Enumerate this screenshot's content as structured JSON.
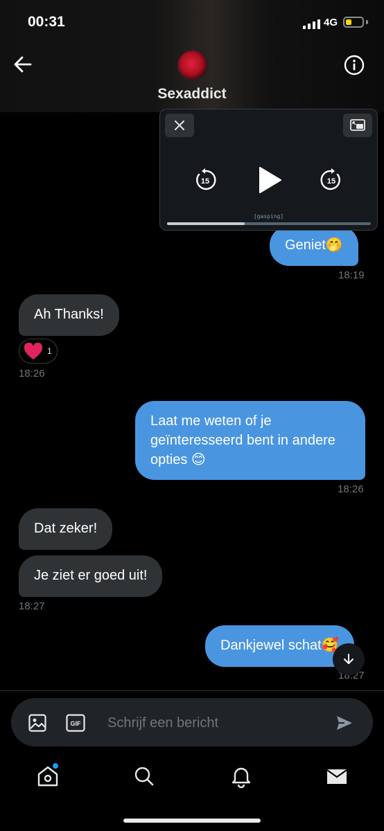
{
  "status_bar": {
    "time": "00:31",
    "network": "4G",
    "battery_level": 0.35
  },
  "header": {
    "name": "Sexaddict",
    "back_icon": "arrow-left-icon",
    "info_icon": "info-icon"
  },
  "player": {
    "caption": "[gasping]",
    "skip_back_seconds": "15",
    "skip_forward_seconds": "15",
    "progress": 0.38,
    "icons": [
      "close-icon",
      "pip-icon",
      "rewind-15-icon",
      "play-icon",
      "forward-15-icon"
    ]
  },
  "messages": [
    {
      "direction": "outgoing",
      "text": "Geniet🤭",
      "time": "18:19"
    },
    {
      "direction": "incoming",
      "text": "Ah Thanks!",
      "reaction": {
        "emoji": "heart",
        "count": "1"
      },
      "time": "18:26"
    },
    {
      "direction": "outgoing",
      "text": "Laat me weten of je geïnteresseerd bent in andere opties 😊",
      "time": "18:26"
    },
    {
      "direction": "incoming",
      "text": "Dat zeker!"
    },
    {
      "direction": "incoming",
      "text": "Je ziet er goed uit!",
      "time": "18:27"
    },
    {
      "direction": "outgoing",
      "text": "Dankjewel schat🥰",
      "time": "18:27"
    }
  ],
  "composer": {
    "placeholder": "Schrijf een bericht",
    "gif_label": "GIF"
  },
  "tab_bar": {
    "items": [
      "home",
      "search",
      "notifications",
      "messages"
    ],
    "active": "messages"
  },
  "colors": {
    "outgoing_bubble": "#4a95e0",
    "incoming_bubble": "#2f3336",
    "accent": "#1d9bf0",
    "background": "#000000"
  }
}
